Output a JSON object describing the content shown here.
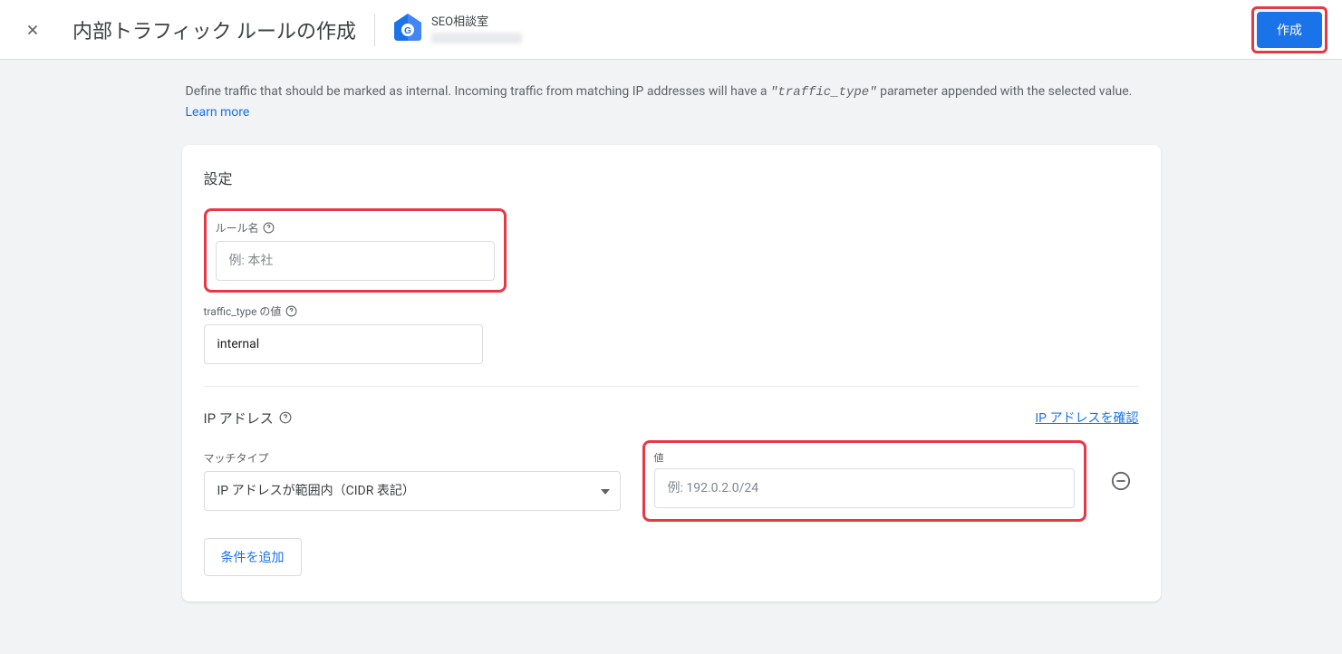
{
  "header": {
    "title": "内部トラフィック ルールの作成",
    "propertyName": "SEO相談室",
    "createButton": "作成"
  },
  "description": {
    "text1": "Define traffic that should be marked as internal. Incoming traffic from matching IP addresses will have a ",
    "code": "\"traffic_type\"",
    "text2": " parameter appended with the selected value. ",
    "learnMore": "Learn more"
  },
  "card": {
    "settingsTitle": "設定",
    "ruleName": {
      "label": "ルール名",
      "placeholder": "例: 本社",
      "value": ""
    },
    "trafficType": {
      "label": "traffic_type の値",
      "value": "internal"
    },
    "ipSection": {
      "title": "IP アドレス",
      "checkIpLink": "IP アドレスを確認",
      "matchTypeLabel": "マッチタイプ",
      "matchTypeValue": "IP アドレスが範囲内（CIDR 表記）",
      "valueLabel": "値",
      "valuePlaceholder": "例: 192.0.2.0/24",
      "valueValue": "",
      "addCondition": "条件を追加"
    }
  }
}
